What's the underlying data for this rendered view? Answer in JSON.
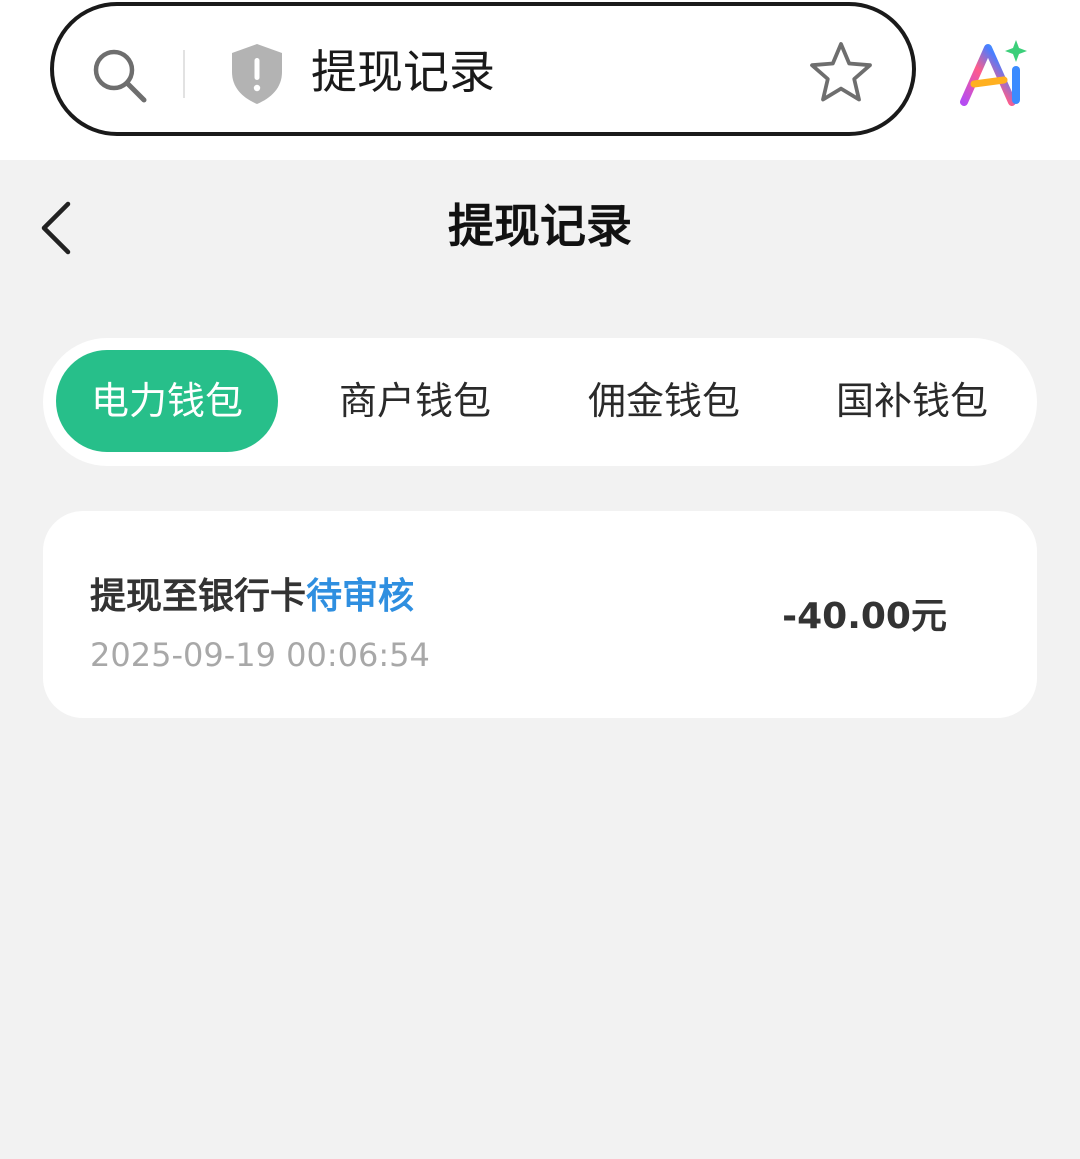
{
  "browser": {
    "address_title": "提现记录",
    "icons": {
      "search": "search-icon",
      "security": "shield-warning-icon",
      "bookmark": "star-icon",
      "assistant": "ai-assistant-icon"
    }
  },
  "header": {
    "title": "提现记录",
    "back_icon": "chevron-left-icon"
  },
  "tabs": [
    {
      "label": "电力钱包",
      "active": true
    },
    {
      "label": "商户钱包",
      "active": false
    },
    {
      "label": "佣金钱包",
      "active": false
    },
    {
      "label": "国补钱包",
      "active": false
    }
  ],
  "records": [
    {
      "title": "提现至银行卡",
      "status": "待审核",
      "time": "2025-09-19 00:06:54",
      "amount": "-40.00元"
    }
  ],
  "colors": {
    "accent": "#27bf8a",
    "status_pending": "#2f8fe0",
    "background": "#f2f2f2"
  }
}
